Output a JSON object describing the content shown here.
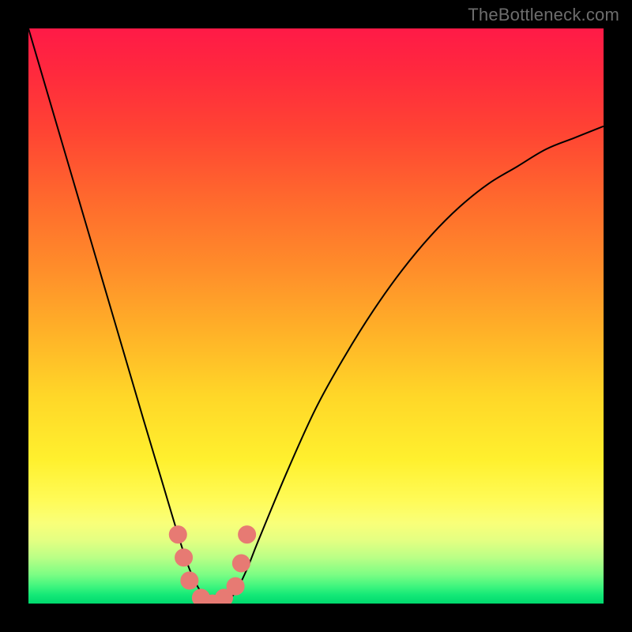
{
  "watermark": "TheBottleneck.com",
  "chart_data": {
    "type": "line",
    "title": "",
    "xlabel": "",
    "ylabel": "",
    "xlim": [
      0,
      100
    ],
    "ylim": [
      0,
      100
    ],
    "grid": false,
    "legend": false,
    "series": [
      {
        "name": "curve",
        "x": [
          0,
          5,
          10,
          15,
          20,
          23,
          26,
          28,
          30,
          32,
          34,
          36,
          38,
          40,
          45,
          50,
          55,
          60,
          65,
          70,
          75,
          80,
          85,
          90,
          95,
          100
        ],
        "values": [
          100,
          83,
          66,
          49,
          32,
          22,
          12,
          6,
          2,
          0,
          0,
          2,
          6,
          11,
          23,
          34,
          43,
          51,
          58,
          64,
          69,
          73,
          76,
          79,
          81,
          83
        ]
      }
    ],
    "markers": {
      "name": "cluster",
      "x": [
        26,
        27,
        28,
        30,
        32,
        34,
        36,
        37,
        38
      ],
      "values": [
        12,
        8,
        4,
        1,
        0,
        1,
        3,
        7,
        12
      ]
    }
  }
}
